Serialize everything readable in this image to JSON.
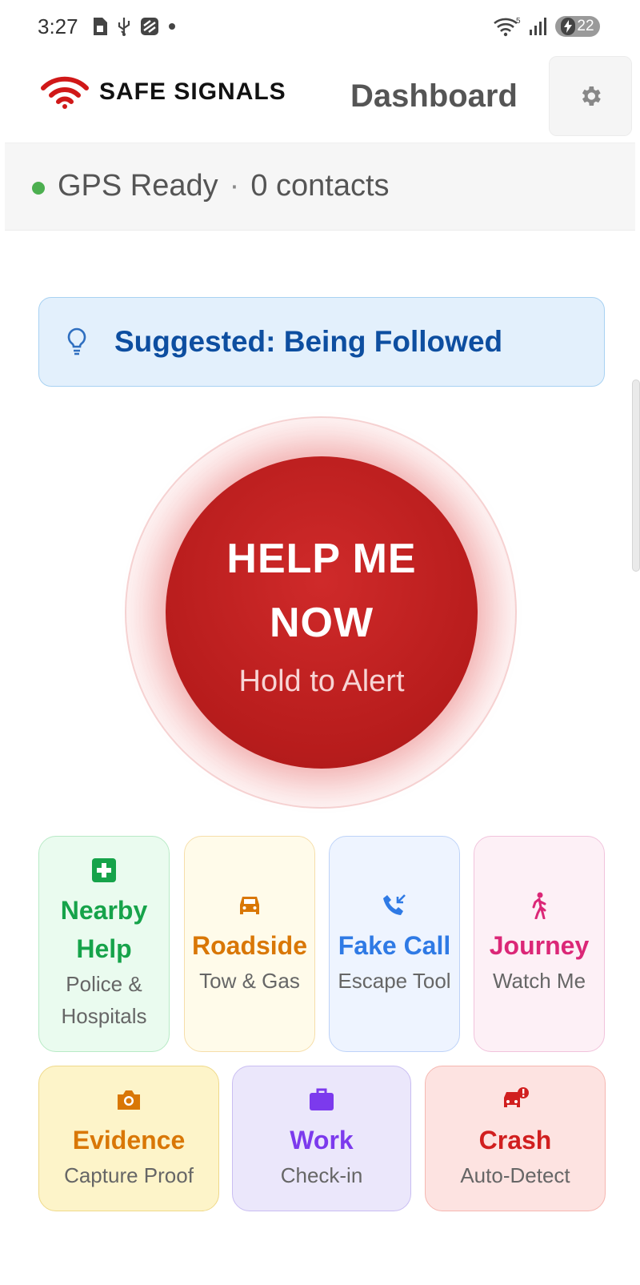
{
  "status_bar": {
    "time": "3:27",
    "signal_badge": "5",
    "battery_level": "22"
  },
  "header": {
    "logo_text": "SAFE SIGNALS",
    "title": "Dashboard"
  },
  "status_line": {
    "gps": "GPS Ready",
    "separator": "·",
    "contacts": "0 contacts",
    "gps_color": "#4caf50"
  },
  "suggestion": {
    "text": "Suggested: Being Followed"
  },
  "help_button": {
    "title": "HELP ME NOW",
    "subtitle": "Hold to Alert",
    "color": "#b71c1c"
  },
  "tiles": [
    {
      "title": "Nearby Help",
      "subtitle": "Police & Hospitals",
      "icon": "medical-cross-icon",
      "color": "#16a34a"
    },
    {
      "title": "Roadside",
      "subtitle": "Tow & Gas",
      "icon": "car-icon",
      "color": "#d97706"
    },
    {
      "title": "Fake Call",
      "subtitle": "Escape Tool",
      "icon": "phone-incoming-icon",
      "color": "#2f7ae5"
    },
    {
      "title": "Journey",
      "subtitle": "Watch Me",
      "icon": "walking-person-icon",
      "color": "#db2777"
    },
    {
      "title": "Evidence",
      "subtitle": "Capture Proof",
      "icon": "camera-icon",
      "color": "#d97706"
    },
    {
      "title": "Work",
      "subtitle": "Check-in",
      "icon": "briefcase-icon",
      "color": "#7c3aed"
    },
    {
      "title": "Crash",
      "subtitle": "Auto-Detect",
      "icon": "car-crash-icon",
      "color": "#d11f1f"
    }
  ]
}
